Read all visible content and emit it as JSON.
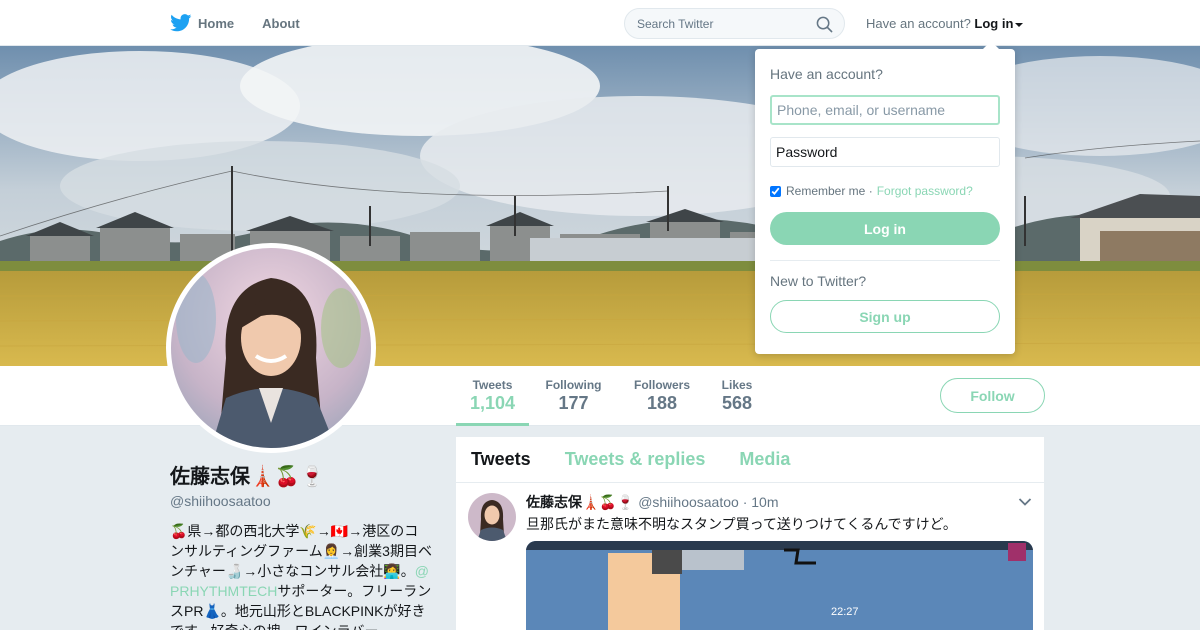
{
  "nav": {
    "home_label": "Home",
    "about_label": "About",
    "search_placeholder": "Search Twitter",
    "have_account_label": "Have an account?",
    "login_label": "Log in"
  },
  "profile": {
    "name": "佐藤志保🗼🍒🍷",
    "handle": "@shiihoosaatoo",
    "bio_before_link": "🍒県→都の西北大学🌾→🇨🇦→港区のコンサルティングファーム👩‍💼→創業3期目ベンチャー🍶→小さなコンサル会社👩‍💻。",
    "bio_link": "@PRHYTHMTECH",
    "bio_after_link": "サポーター。フリーランスPR👗。地元山形とBLACKPINKが好きです。好奇心の塊。ワインラバー"
  },
  "stats": [
    {
      "label": "Tweets",
      "value": "1,104",
      "active": true
    },
    {
      "label": "Following",
      "value": "177",
      "active": false
    },
    {
      "label": "Followers",
      "value": "188",
      "active": false
    },
    {
      "label": "Likes",
      "value": "568",
      "active": false
    }
  ],
  "follow_label": "Follow",
  "tabs": [
    {
      "label": "Tweets",
      "active": true
    },
    {
      "label": "Tweets & replies",
      "active": false
    },
    {
      "label": "Media",
      "active": false
    }
  ],
  "tweet": {
    "name": "佐藤志保🗼🍒🍷",
    "handle": "@shiihoosaatoo",
    "separator": "·",
    "time": "10m",
    "text": "旦那氏がまた意味不明なスタンプ買って送りつけてくるんですけど。",
    "media_time": "22:27"
  },
  "login_dropdown": {
    "title": "Have an account?",
    "username_placeholder": "Phone, email, or username",
    "password_placeholder": "Password",
    "remember_label": "Remember me",
    "separator": "·",
    "forgot_label": "Forgot password?",
    "login_button": "Log in",
    "new_label": "New to Twitter?",
    "signup_button": "Sign up"
  },
  "colors": {
    "accent": "#8ad6b4",
    "twitter_blue": "#1da1f2"
  }
}
